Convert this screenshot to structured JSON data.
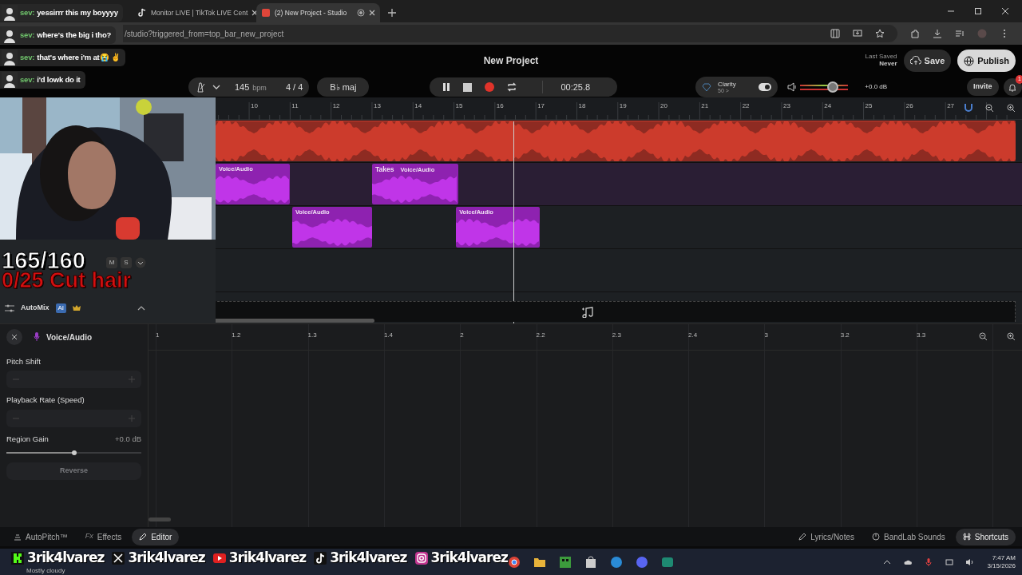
{
  "browser": {
    "tabs": [
      {
        "title": "Monitor LIVE | TikTok LIVE Cent",
        "selected": false
      },
      {
        "title": "(2) New Project - Studio",
        "selected": true
      }
    ],
    "url": "/studio?triggered_from=top_bar_new_project"
  },
  "header": {
    "title": "New Project",
    "last_saved_label": "Last Saved",
    "last_saved_value": "Never",
    "save": "Save",
    "publish": "Publish"
  },
  "toolbar": {
    "tempo": "145",
    "tempo_unit": "bpm",
    "time_signature": "4 / 4",
    "key": "B♭ maj",
    "playing": true,
    "time": "00:25.8",
    "clarity_label": "Clarity",
    "clarity_value": "50 >",
    "clarity_on": true,
    "master_volume": {
      "level": 0.68,
      "reading": "+0.0 dB"
    },
    "invite": "Invite",
    "notifications": "1"
  },
  "ruler": [
    "10",
    "11",
    "12",
    "13",
    "14",
    "15",
    "16",
    "17",
    "18",
    "19",
    "20",
    "21",
    "22",
    "23",
    "24",
    "25",
    "26",
    "27"
  ],
  "tracks": [
    {
      "color": "#cc3b2c",
      "regions": [
        {
          "kind": "audio"
        }
      ]
    },
    {
      "color": "#8e22b0",
      "regions": [
        {
          "kind": "audio",
          "label": "Voice/Audio"
        },
        {
          "kind": "audio",
          "takes": "Takes",
          "label": "Voice/Audio"
        }
      ]
    },
    {
      "color": "#8e22b0",
      "regions": [
        {
          "kind": "audio",
          "label": "Voice/Audio"
        },
        {
          "kind": "audio",
          "label": "Voice/Audio"
        }
      ]
    }
  ],
  "track_controls": {
    "mute": "M",
    "solo": "S"
  },
  "automix": {
    "label": "AutoMix",
    "badge": "AI"
  },
  "editor": {
    "track_name": "Voice/Audio",
    "pitch_label": "Pitch Shift",
    "rate_label": "Playback Rate (Speed)",
    "region_gain": {
      "label": "Region Gain",
      "reading": "+0.0 dB",
      "level": 0.5
    },
    "reverse": "Reverse",
    "reverse_disabled": true,
    "ruler": [
      "1",
      "1.2",
      "1.3",
      "1.4",
      "2",
      "2.2",
      "2.3",
      "2.4",
      "3",
      "3.2",
      "3.3"
    ]
  },
  "bottom_tabs": [
    {
      "label": "AutoPitch™",
      "selected": false
    },
    {
      "icon_text": "Fx",
      "label": "Effects",
      "selected": false
    },
    {
      "label": "Editor",
      "selected": true
    }
  ],
  "bottom_buttons": [
    "Lyrics/Notes",
    "BandLab Sounds",
    "Shortcuts"
  ],
  "taskbar": {
    "weather": "Mostly cloudy",
    "time": "7:47 AM",
    "date": "3/15/2026"
  },
  "overlay": {
    "chat": [
      {
        "user": "sev:",
        "text": "yessirrr this my boyyyy"
      },
      {
        "user": "sev:",
        "text": "where's the big i tho?"
      },
      {
        "user": "sev:",
        "text": "that's where i'm at😭 ✌️"
      },
      {
        "user": "sev:",
        "text": "i'd lowk do it"
      }
    ],
    "counter": "165/160",
    "goal": "0/25 Cut hair",
    "socials": [
      {
        "kind": "kick",
        "handle": "3rik4lvarez"
      },
      {
        "kind": "x",
        "handle": "3rik4lvarez"
      },
      {
        "kind": "youtube",
        "handle": "3rik4lvarez"
      },
      {
        "kind": "tiktok",
        "handle": "3rik4lvarez"
      },
      {
        "kind": "instagram",
        "handle": "3rik4lvarez"
      }
    ]
  }
}
